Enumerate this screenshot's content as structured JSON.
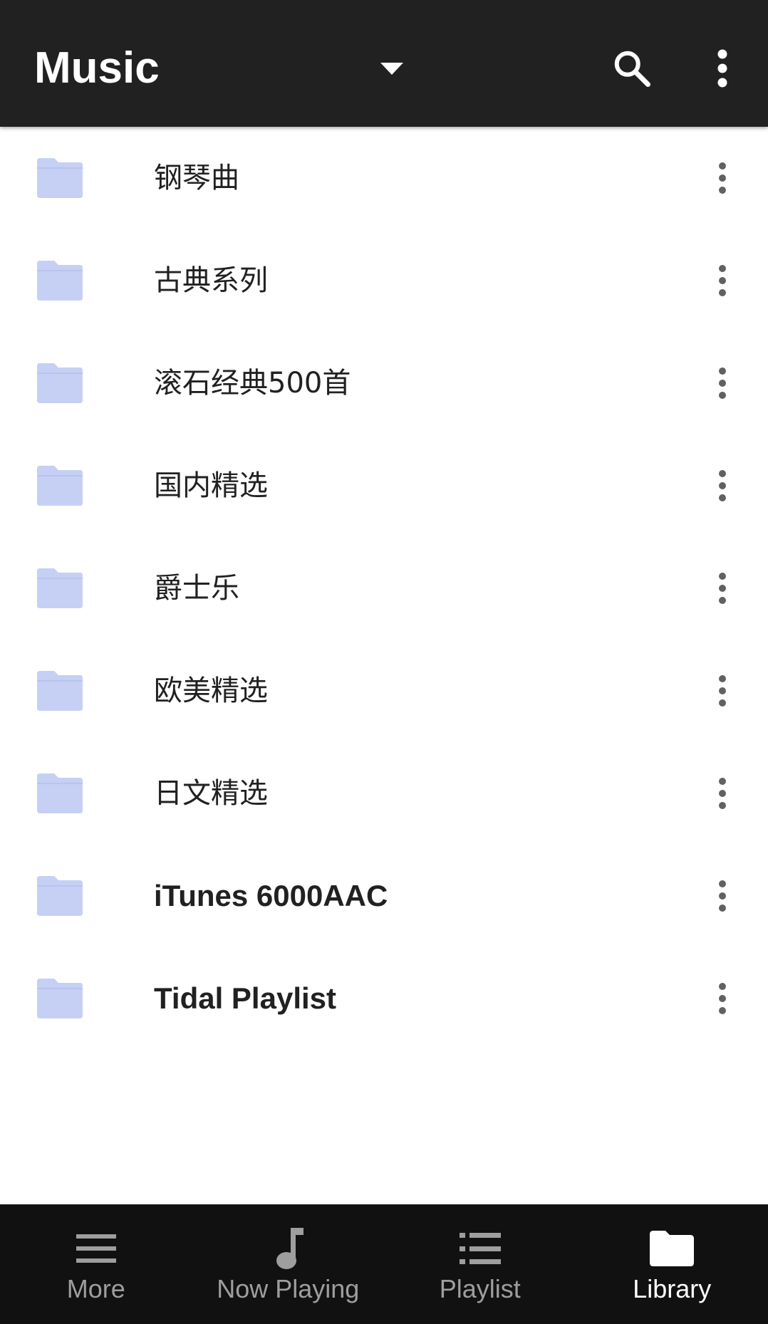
{
  "app_bar": {
    "title": "Music",
    "icons": {
      "dropdown": "chevron-down-icon",
      "search": "search-icon",
      "more": "more-vert-icon"
    }
  },
  "colors": {
    "app_bar_bg": "#212121",
    "bottom_nav_bg": "#111111",
    "folder": "#c5d0f4",
    "text": "#212121",
    "menu_dots": "#616161",
    "nav_inactive": "#9e9e9e",
    "nav_active": "#ffffff"
  },
  "folders": [
    {
      "label": "钢琴曲",
      "icon": "folder-icon"
    },
    {
      "label": "古典系列",
      "icon": "folder-icon"
    },
    {
      "label": "滚石经典500首",
      "icon": "folder-icon"
    },
    {
      "label": "国内精选",
      "icon": "folder-icon"
    },
    {
      "label": "爵士乐",
      "icon": "folder-icon"
    },
    {
      "label": "欧美精选",
      "icon": "folder-icon"
    },
    {
      "label": "日文精选",
      "icon": "folder-icon"
    },
    {
      "label": "iTunes 6000AAC",
      "icon": "folder-icon"
    },
    {
      "label": "Tidal Playlist",
      "icon": "folder-icon"
    }
  ],
  "bottom_nav": {
    "items": [
      {
        "label": "More",
        "icon": "menu-icon",
        "active": false
      },
      {
        "label": "Now Playing",
        "icon": "music-note-icon",
        "active": false
      },
      {
        "label": "Playlist",
        "icon": "list-icon",
        "active": false
      },
      {
        "label": "Library",
        "icon": "folder-icon",
        "active": true
      }
    ]
  }
}
